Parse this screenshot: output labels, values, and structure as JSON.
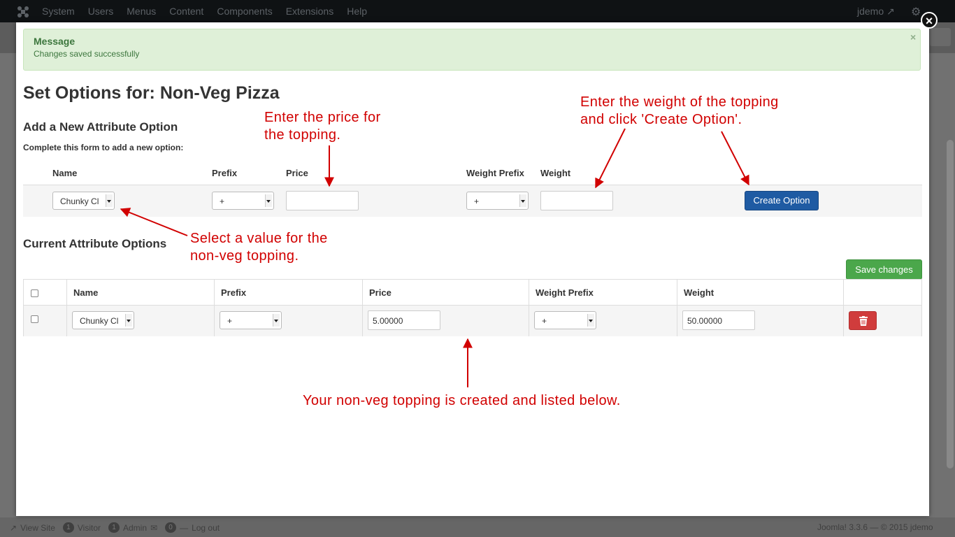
{
  "topbar": {
    "menu": [
      "System",
      "Users",
      "Menus",
      "Content",
      "Components",
      "Extensions",
      "Help"
    ],
    "user": "jdemo"
  },
  "footer": {
    "view_site": "View Site",
    "visitor_count": "1",
    "visitor_label": "Visitor",
    "admin_count": "1",
    "admin_label": "Admin",
    "messages_count": "0",
    "logout": "Log out",
    "version": "Joomla! 3.3.6 — © 2015 jdemo"
  },
  "modal": {
    "alert": {
      "title": "Message",
      "text": "Changes saved successfully",
      "close": "×"
    },
    "page_title": "Set Options for: Non-Veg Pizza",
    "add_heading": "Add a New Attribute Option",
    "add_help": "Complete this form to add a new option:",
    "form_columns": [
      "Name",
      "Prefix",
      "Price",
      "Weight Prefix",
      "Weight"
    ],
    "form": {
      "name_value": "Chunky Cl",
      "prefix_value": "+",
      "price_value": "",
      "weight_prefix_value": "+",
      "weight_value": "",
      "create_button": "Create Option"
    },
    "current_heading": "Current Attribute Options",
    "save_button": "Save changes",
    "table_columns": [
      "Name",
      "Prefix",
      "Price",
      "Weight Prefix",
      "Weight"
    ],
    "rows": [
      {
        "name": "Chunky Cl",
        "prefix": "+",
        "price": "5.00000",
        "weight_prefix": "+",
        "weight": "50.00000"
      }
    ]
  },
  "annotations": {
    "price": [
      "Enter the price for",
      "the topping."
    ],
    "weight": [
      "Enter the weight of the topping",
      "and click 'Create Option'."
    ],
    "select": [
      "Select a value for the",
      "non-veg topping."
    ],
    "created": "Your non-veg topping is created and listed below."
  },
  "colors": {
    "annotation": "#d10000",
    "primary": "#1f5ba3",
    "success": "#4ba74b",
    "danger": "#d03c3c",
    "alert_bg": "#dff0d8",
    "alert_text": "#3c763d"
  }
}
